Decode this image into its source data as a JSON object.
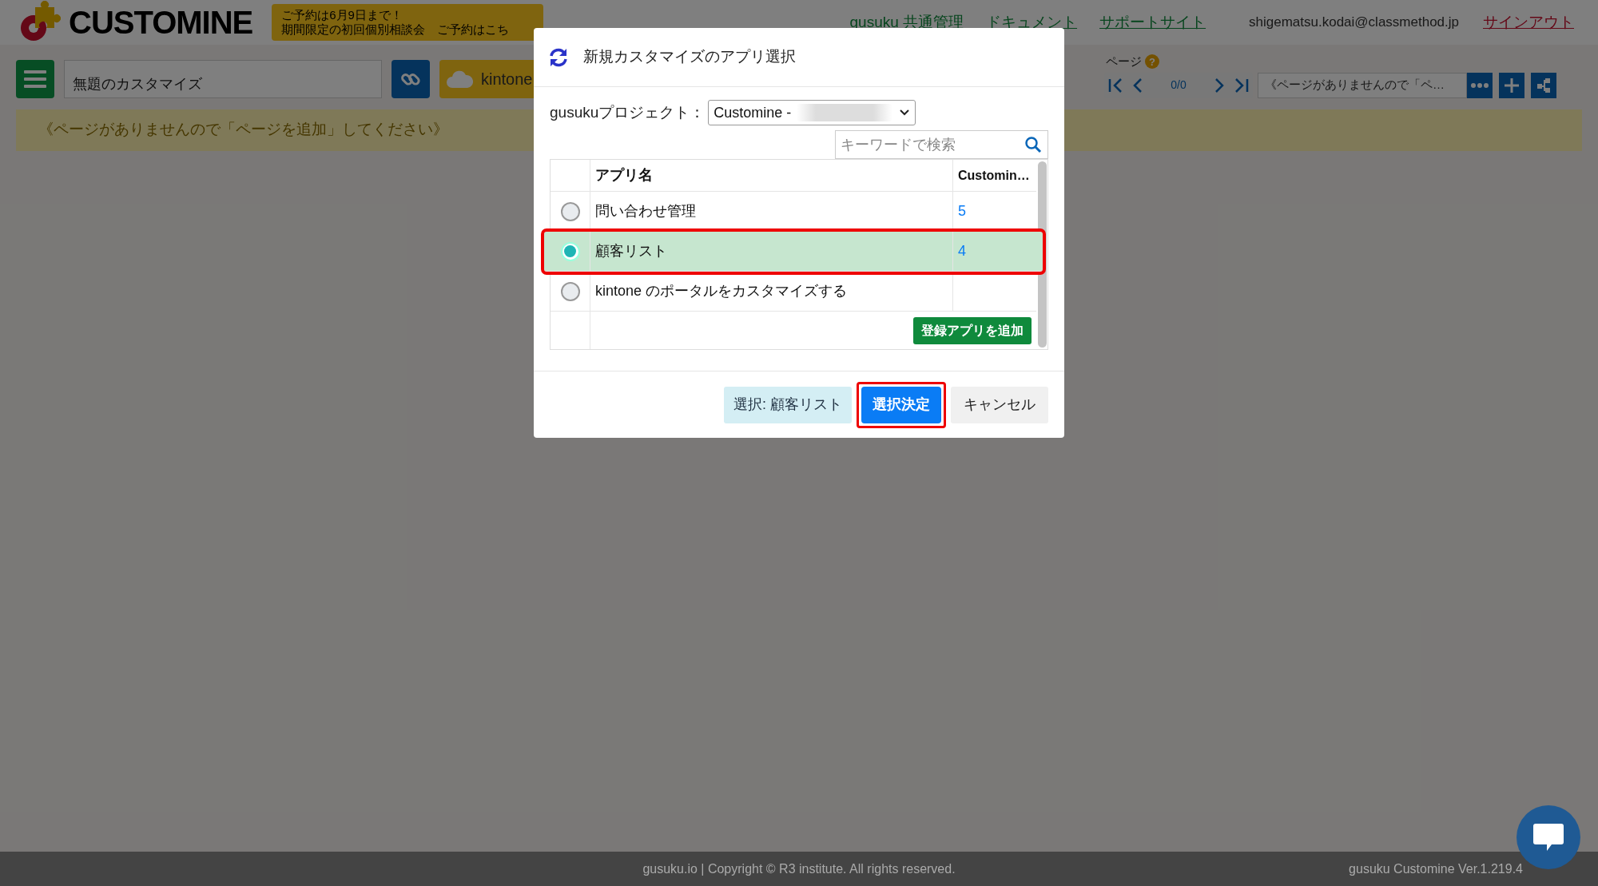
{
  "header": {
    "logo": "CUSTOMINE",
    "banner_lines": [
      "ご予約は6月9日まで！",
      "期間限定の初回個別相談会　ご予約はこち"
    ],
    "nav_links": [
      "gusuku 共通管理",
      "ドキュメント",
      "サポートサイト"
    ],
    "user_email": "shigematsu.kodai@classmethod.jp",
    "sign_out": "サインアウト"
  },
  "toolbar": {
    "title_value": "無題のカスタマイズ",
    "kintone_button": "kintone",
    "page_label": "ページ",
    "help": "?",
    "pager": "0/0",
    "page_select": "《ページがありませんので「ペ…"
  },
  "message": "《ページがありませんので「ページを追加」してください》",
  "dialog": {
    "title": "新規カスタマイズのアプリ選択",
    "project_label": "gusukuプロジェクト：",
    "project_value": "Customine - ",
    "search": {
      "placeholder": "キーワードで検索"
    },
    "columns": [
      "アプリ名",
      "Customin…"
    ],
    "rows": [
      {
        "name": "問い合わせ管理",
        "count": "5",
        "selected": false
      },
      {
        "name": "顧客リスト",
        "count": "4",
        "selected": true
      },
      {
        "name": "kintone のポータルをカスタマイズする",
        "selected": false
      }
    ],
    "add_button": "登録アプリを追加",
    "selection_text": "選択: 顧客リスト",
    "confirm_button": "選択決定",
    "cancel_button": "キャンセル"
  },
  "footer": {
    "copyright": "gusuku.io | Copyright © R3 institute. All rights reserved.",
    "version": "gusuku Customine Ver.1.219.4"
  }
}
